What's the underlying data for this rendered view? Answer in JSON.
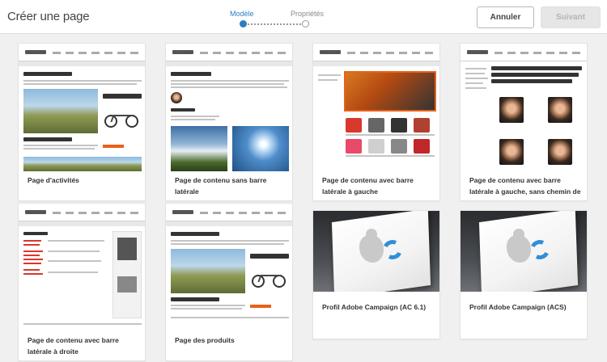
{
  "header": {
    "title": "Créer une page",
    "steps": [
      {
        "label": "Modèle",
        "active": true
      },
      {
        "label": "Propriétés",
        "active": false
      }
    ],
    "cancel_label": "Annuler",
    "next_label": "Suivant"
  },
  "templates": [
    {
      "label": "Page d'activités"
    },
    {
      "label": "Page de contenu sans barre latérale"
    },
    {
      "label": "Page de contenu avec barre latérale à gauche"
    },
    {
      "label": "Page de contenu avec barre latérale à gauche, sans chemin de navigation"
    },
    {
      "label": "Page de contenu avec barre latérale à droite"
    },
    {
      "label": "Page des produits"
    },
    {
      "label": "Profil Adobe Campaign (AC 6.1)"
    },
    {
      "label": "Profil Adobe Campaign (ACS)"
    }
  ],
  "colors": {
    "accent": "#2f7bc4",
    "brand_orange": "#e8611a"
  }
}
